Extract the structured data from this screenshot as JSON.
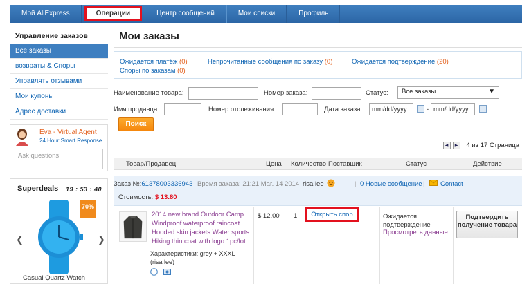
{
  "nav": {
    "items": [
      "Мой AliExpress",
      "Операции",
      "Центр сообщений",
      "Мои списки",
      "Профиль"
    ]
  },
  "sidebar": {
    "title": "Управление заказов",
    "items": [
      "Все заказы",
      "возвраты & Споры",
      "Управлять отзывами",
      "Мои купоны",
      "Адрес доставки"
    ]
  },
  "agent": {
    "name": "Eva - Virtual Agent",
    "subtitle": "24 Hour Smart Response",
    "placeholder": "Ask questions"
  },
  "deals": {
    "title": "Superdeals",
    "timer": "19 : 53 : 40",
    "badge": "70%",
    "product": "Casual Quartz Watch"
  },
  "main": {
    "title": "Мои заказы",
    "filters": [
      {
        "label": "Ожидается платёж",
        "count": "(0)"
      },
      {
        "label": "Непрочитанные сообщения по заказу",
        "count": "(0)"
      },
      {
        "label": "Ожидается подтверждение",
        "count": "(20)"
      },
      {
        "label": "Споры по заказам",
        "count": "(0)"
      }
    ],
    "form": {
      "product_label": "Наименование товара:",
      "order_no_label": "Номер заказа:",
      "status_label": "Статус:",
      "status_value": "Все заказы",
      "seller_label": "Имя продавца:",
      "tracking_label": "Номер отслеживания:",
      "date_label": "Дата заказа:",
      "date_from": "mm/dd/yyyy",
      "date_to": "mm/dd/yyyy",
      "date_sep": "-",
      "search_button": "Поиск"
    },
    "pager": {
      "text": "4 из 17 Страница"
    },
    "table_headers": [
      "Товар/Продавец",
      "Цена",
      "Количество",
      "Поставщик",
      "Статус",
      "Действие"
    ],
    "order": {
      "order_label": "Заказ №:",
      "order_number": "61378003336943",
      "time_label": "Время заказа:",
      "time_value": "21:21 Mar. 14 2014",
      "seller": "risa lee",
      "new_messages": "0 Новые сообщение",
      "contact": "Contact",
      "sep": "|",
      "cost_label": "Стоимость:",
      "cost_value": "$ 13.80",
      "product_title": "2014 new brand Outdoor Camp Windproof waterproof raincoat Hooded skin jackets Water sports Hiking thin coat with logo 1pc/lot",
      "attr_line": "Характеристики: grey   + XXXL",
      "seller_paren": "(risa lee)",
      "price": "$ 12.00",
      "qty": "1",
      "dispute_button": "Открыть спор",
      "status_text": "Ожидается подтверждение",
      "status_link": "Просмотреть данные",
      "confirm_button": "Подтвердить получение товара"
    }
  }
}
